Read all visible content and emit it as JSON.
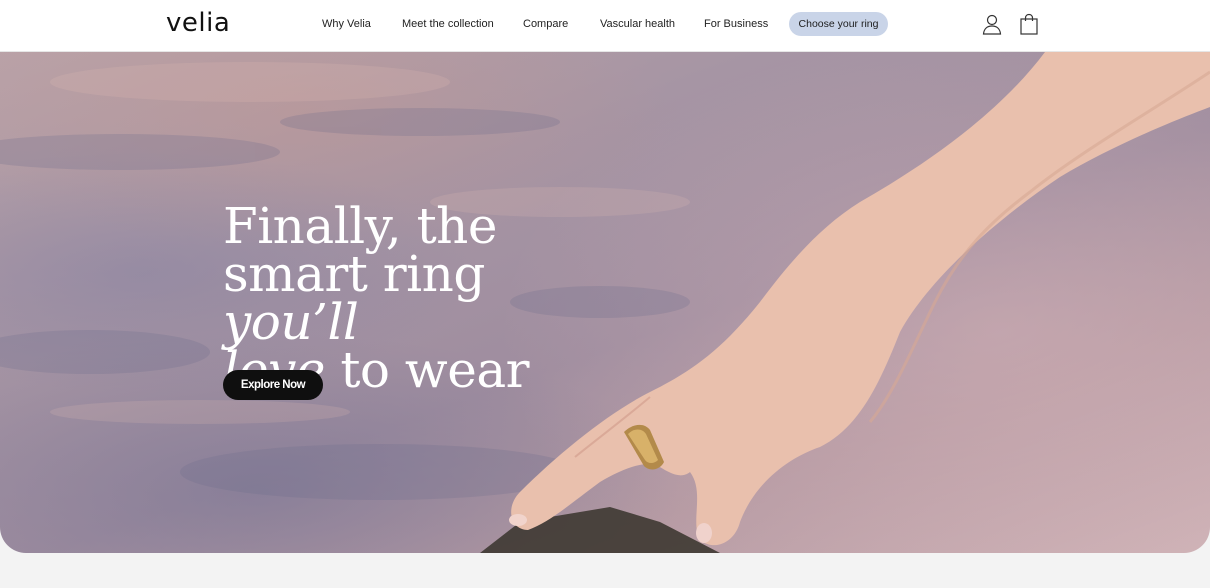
{
  "brand": {
    "logo_text": "velia"
  },
  "nav": {
    "links": [
      {
        "label": "Why Velia"
      },
      {
        "label": "Meet the collection"
      },
      {
        "label": "Compare"
      },
      {
        "label": "Vascular health"
      },
      {
        "label": "For Business"
      }
    ],
    "cta_label": "Choose your ring",
    "icons": [
      "account-icon",
      "shopping-bag-icon"
    ]
  },
  "hero": {
    "line1": "Finally, the",
    "line2_regular": "smart ring",
    "line2_italic": "you’ll",
    "line3_italic": "love",
    "line3_regular": "to wear",
    "button_label": "Explore Now"
  },
  "colors": {
    "cta_background": "#c9d4e8",
    "hero_button": "#0f0f0f",
    "page_background": "#f3f3f3"
  }
}
